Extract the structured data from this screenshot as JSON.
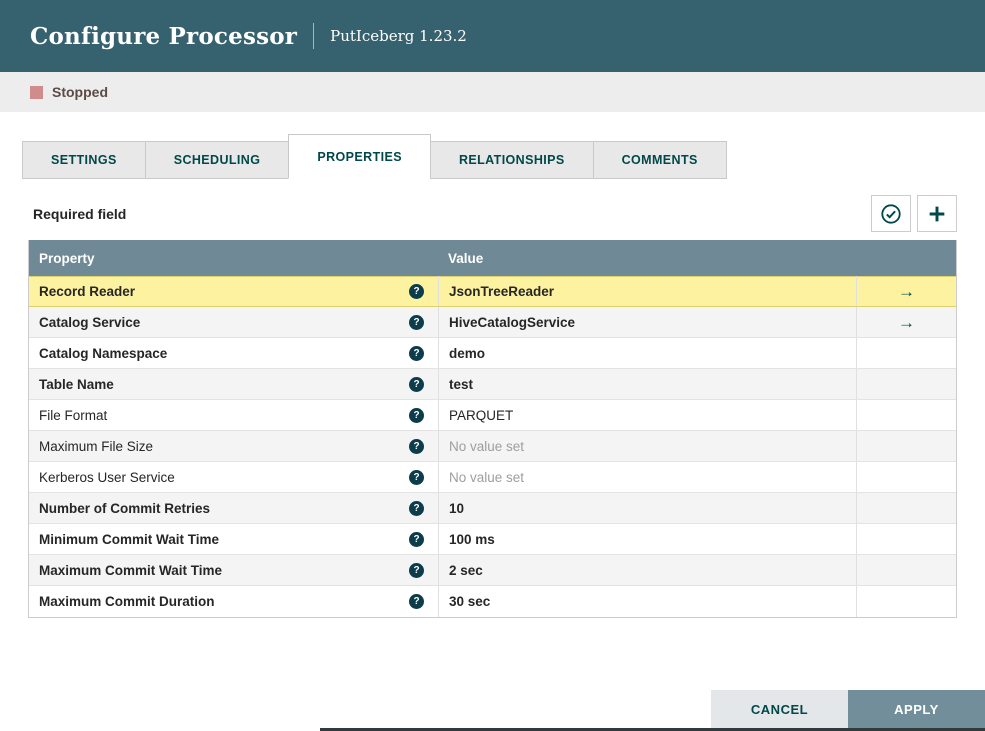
{
  "header": {
    "title": "Configure Processor",
    "subtitle": "PutIceberg 1.23.2"
  },
  "status": {
    "label": "Stopped",
    "color": "#d08c8c"
  },
  "tabs": [
    {
      "label": "SETTINGS",
      "active": false
    },
    {
      "label": "SCHEDULING",
      "active": false
    },
    {
      "label": "PROPERTIES",
      "active": true
    },
    {
      "label": "RELATIONSHIPS",
      "active": false
    },
    {
      "label": "COMMENTS",
      "active": false
    }
  ],
  "panel": {
    "required_label": "Required field",
    "icons": {
      "verify": "check-circle",
      "add": "plus",
      "help": "question-circle",
      "goto": "right-arrow"
    }
  },
  "table": {
    "columns": [
      "Property",
      "Value"
    ],
    "rows": [
      {
        "property": "Record Reader",
        "value": "JsonTreeReader",
        "property_bold": true,
        "value_bold": true,
        "placeholder": false,
        "highlighted": true,
        "has_arrow": true,
        "has_help": true
      },
      {
        "property": "Catalog Service",
        "value": "HiveCatalogService",
        "property_bold": true,
        "value_bold": true,
        "placeholder": false,
        "highlighted": false,
        "has_arrow": true,
        "has_help": true
      },
      {
        "property": "Catalog Namespace",
        "value": "demo",
        "property_bold": true,
        "value_bold": true,
        "placeholder": false,
        "highlighted": false,
        "has_arrow": false,
        "has_help": true
      },
      {
        "property": "Table Name",
        "value": "test",
        "property_bold": true,
        "value_bold": true,
        "placeholder": false,
        "highlighted": false,
        "has_arrow": false,
        "has_help": true
      },
      {
        "property": "File Format",
        "value": "PARQUET",
        "property_bold": false,
        "value_bold": false,
        "placeholder": false,
        "highlighted": false,
        "has_arrow": false,
        "has_help": true
      },
      {
        "property": "Maximum File Size",
        "value": "No value set",
        "property_bold": false,
        "value_bold": false,
        "placeholder": true,
        "highlighted": false,
        "has_arrow": false,
        "has_help": true
      },
      {
        "property": "Kerberos User Service",
        "value": "No value set",
        "property_bold": false,
        "value_bold": false,
        "placeholder": true,
        "highlighted": false,
        "has_arrow": false,
        "has_help": true
      },
      {
        "property": "Number of Commit Retries",
        "value": "10",
        "property_bold": true,
        "value_bold": true,
        "placeholder": false,
        "highlighted": false,
        "has_arrow": false,
        "has_help": true
      },
      {
        "property": "Minimum Commit Wait Time",
        "value": "100 ms",
        "property_bold": true,
        "value_bold": true,
        "placeholder": false,
        "highlighted": false,
        "has_arrow": false,
        "has_help": true
      },
      {
        "property": "Maximum Commit Wait Time",
        "value": "2 sec",
        "property_bold": true,
        "value_bold": true,
        "placeholder": false,
        "highlighted": false,
        "has_arrow": false,
        "has_help": true
      },
      {
        "property": "Maximum Commit Duration",
        "value": "30 sec",
        "property_bold": true,
        "value_bold": true,
        "placeholder": false,
        "highlighted": false,
        "has_arrow": false,
        "has_help": true
      }
    ]
  },
  "footer": {
    "cancel": "CANCEL",
    "apply": "APPLY"
  },
  "colors": {
    "accent": "#004849",
    "header_bg": "#36616e",
    "table_header_bg": "#6f8a96",
    "highlight_row": "#fcf2a0",
    "apply_bg": "#728e9b",
    "stopped_red": "#d08c8c"
  }
}
